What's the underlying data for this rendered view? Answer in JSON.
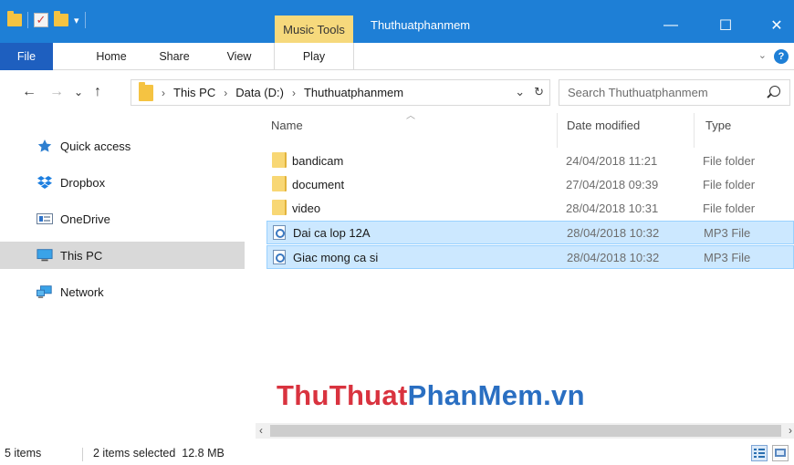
{
  "titlebar": {
    "contextual_tab": "Music Tools",
    "window_title": "Thuthuatphanmem",
    "minimize": "—",
    "maximize": "☐",
    "close": "✕"
  },
  "ribbon": {
    "tabs": [
      "File",
      "Home",
      "Share",
      "View",
      "Play"
    ]
  },
  "address": {
    "back": "←",
    "forward": "→",
    "recent": "⌄",
    "up": "↑",
    "path": [
      "This PC",
      "Data (D:)",
      "Thuthuatphanmem"
    ],
    "separator": "›",
    "search_placeholder": "Search Thuthuatphanmem"
  },
  "navpane": {
    "items": [
      {
        "label": "Quick access",
        "icon": "star-icon"
      },
      {
        "label": "Dropbox",
        "icon": "dropbox-icon"
      },
      {
        "label": "OneDrive",
        "icon": "onedrive-icon"
      },
      {
        "label": "This PC",
        "icon": "computer-icon",
        "selected": true
      },
      {
        "label": "Network",
        "icon": "network-icon"
      }
    ]
  },
  "filelist": {
    "columns": {
      "name": "Name",
      "date": "Date modified",
      "type": "Type"
    },
    "rows": [
      {
        "name": "bandicam",
        "date": "24/04/2018 11:21",
        "type": "File folder",
        "kind": "folder",
        "selected": false
      },
      {
        "name": "document",
        "date": "27/04/2018 09:39",
        "type": "File folder",
        "kind": "folder",
        "selected": false
      },
      {
        "name": "video",
        "date": "28/04/2018 10:31",
        "type": "File folder",
        "kind": "folder",
        "selected": false
      },
      {
        "name": "Dai ca lop 12A",
        "date": "28/04/2018 10:32",
        "type": "MP3 File",
        "kind": "mp3",
        "selected": true
      },
      {
        "name": "Giac mong ca si",
        "date": "28/04/2018 10:32",
        "type": "MP3 File",
        "kind": "mp3",
        "selected": true
      }
    ]
  },
  "watermark": {
    "part1": "ThuThuat",
    "part2": "PhanMem",
    "part3": ".vn",
    "color1": "#d9333f",
    "color2": "#2a6fc2"
  },
  "statusbar": {
    "item_count": "5 items",
    "selection": "2 items selected  12.8 MB"
  },
  "colors": {
    "titlebar": "#1e7fd6",
    "file_tab": "#1e5fbf",
    "music_tools": "#f6d97c",
    "selection": "#cce8ff",
    "nav_selected": "#d9d9d9"
  }
}
